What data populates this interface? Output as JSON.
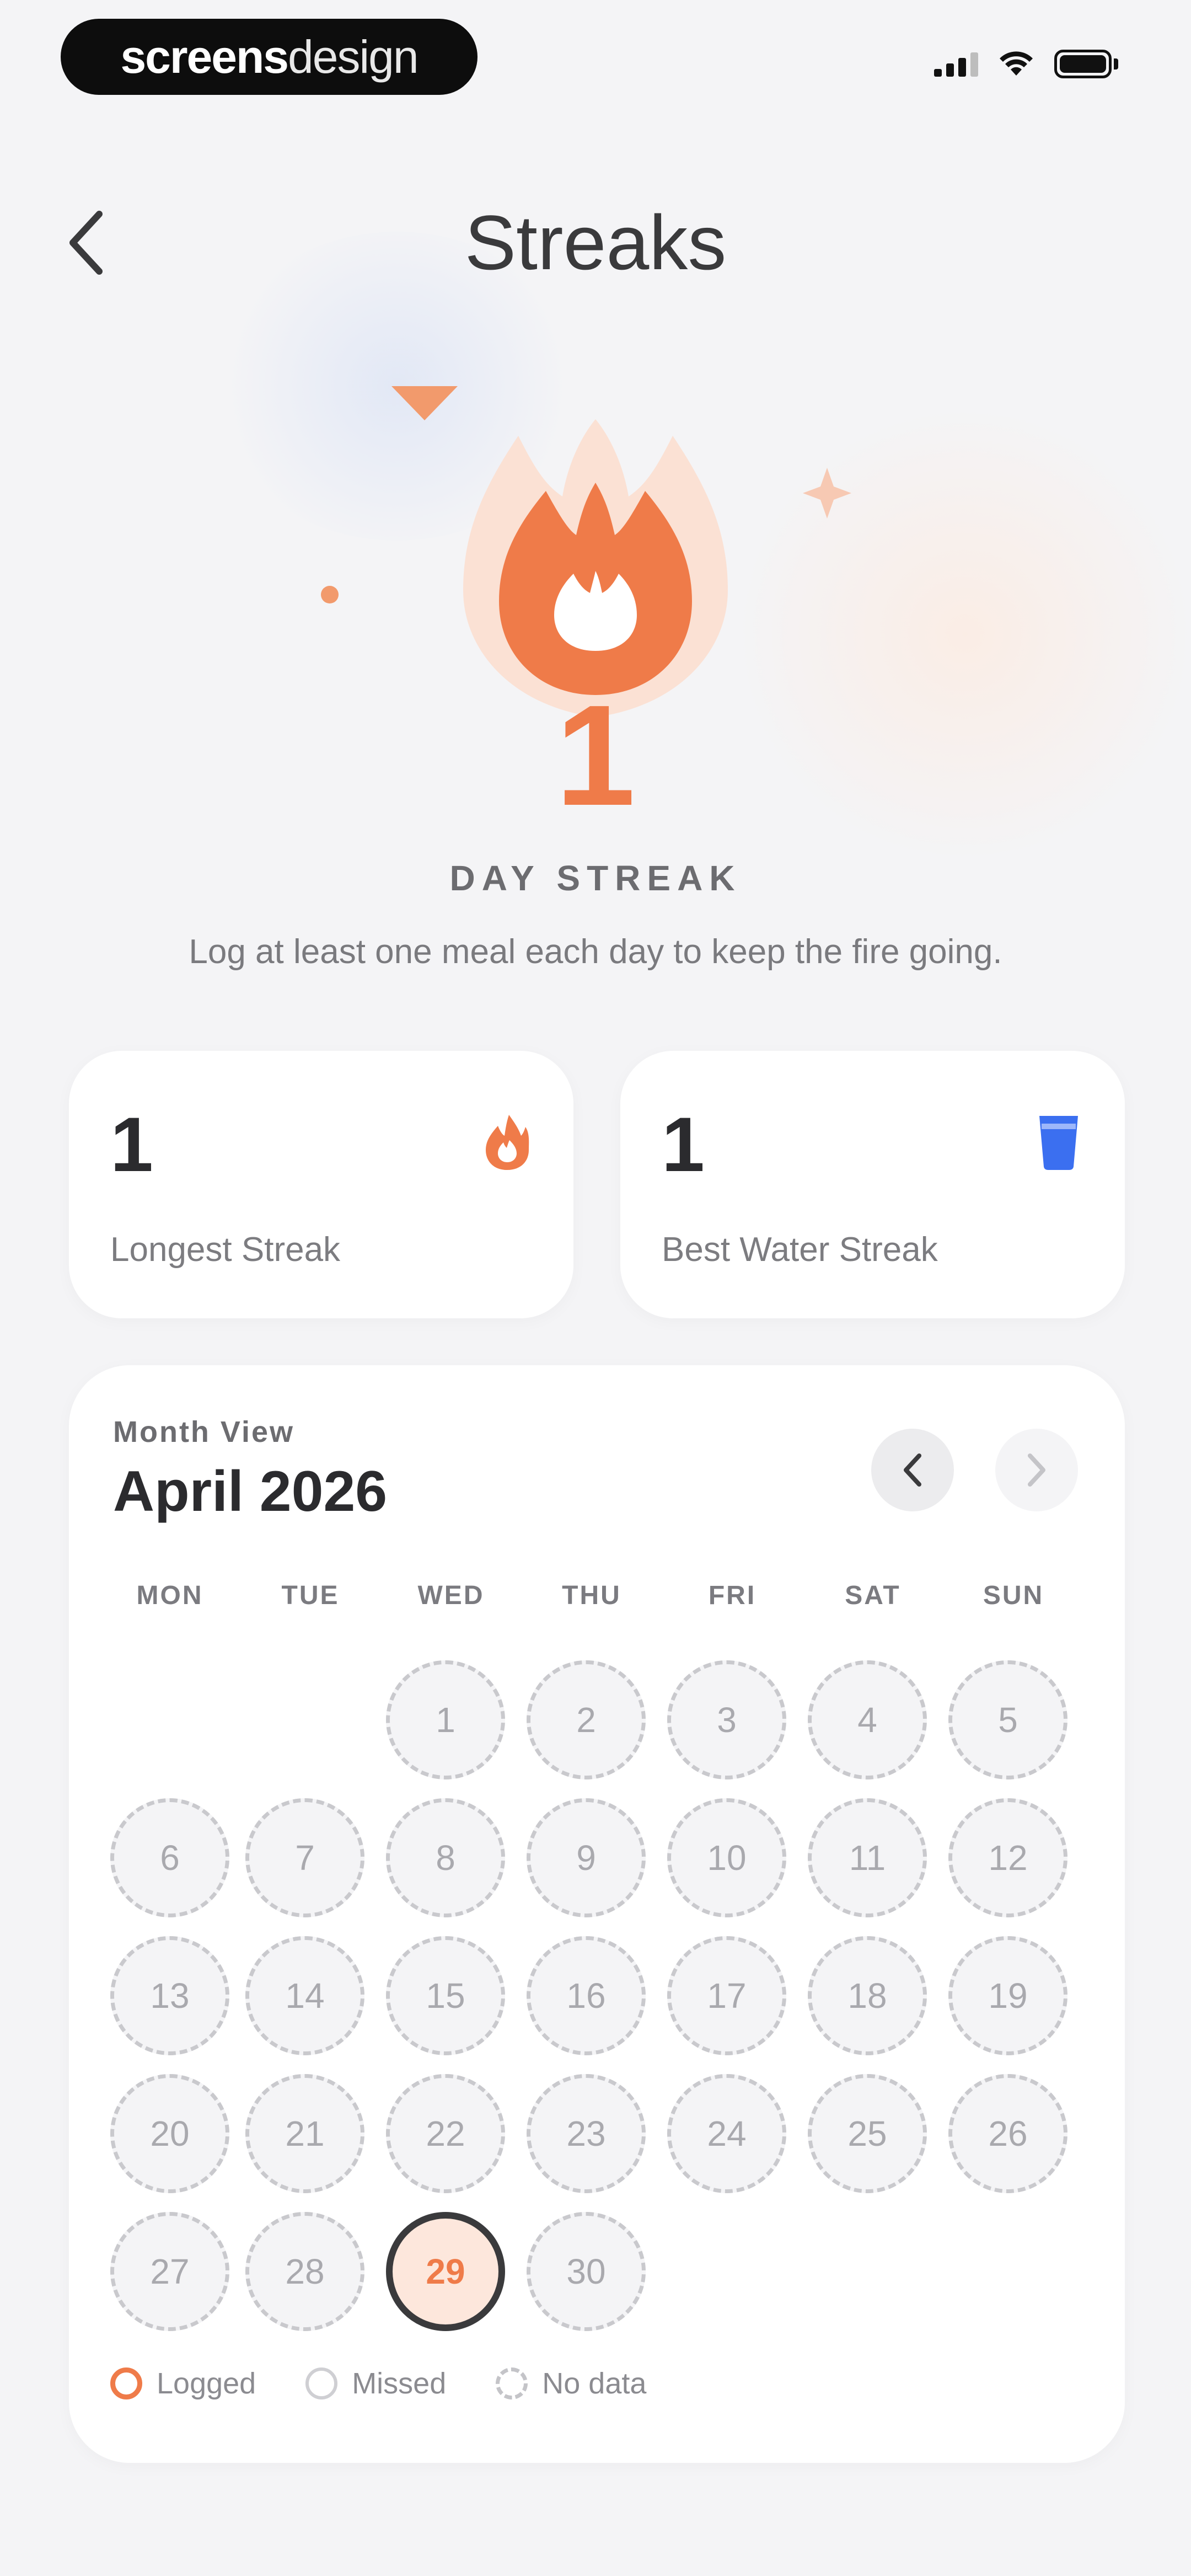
{
  "brand": {
    "bold": "screens",
    "light": "design"
  },
  "header": {
    "title": "Streaks"
  },
  "hero": {
    "streak_count": "1",
    "streak_label": "DAY STREAK",
    "description": "Log at least one meal each day to keep the fire going."
  },
  "stats": [
    {
      "value": "1",
      "label": "Longest Streak",
      "icon": "flame-icon"
    },
    {
      "value": "1",
      "label": "Best Water Streak",
      "icon": "water-glass-icon"
    }
  ],
  "calendar": {
    "eyebrow": "Month View",
    "title": "April 2026",
    "weekdays": [
      "MON",
      "TUE",
      "WED",
      "THU",
      "FRI",
      "SAT",
      "SUN"
    ],
    "days": [
      "1",
      "2",
      "3",
      "4",
      "5",
      "6",
      "7",
      "8",
      "9",
      "10",
      "11",
      "12",
      "13",
      "14",
      "15",
      "16",
      "17",
      "18",
      "19",
      "20",
      "21",
      "22",
      "23",
      "24",
      "25",
      "26",
      "27",
      "28",
      "29",
      "30"
    ],
    "logged_day": "29"
  },
  "legend": {
    "logged": "Logged",
    "missed": "Missed",
    "no_data": "No data"
  },
  "colors": {
    "accent": "#ef7b49",
    "water": "#3b6ff0",
    "logged_fill": "#fde7dc"
  }
}
